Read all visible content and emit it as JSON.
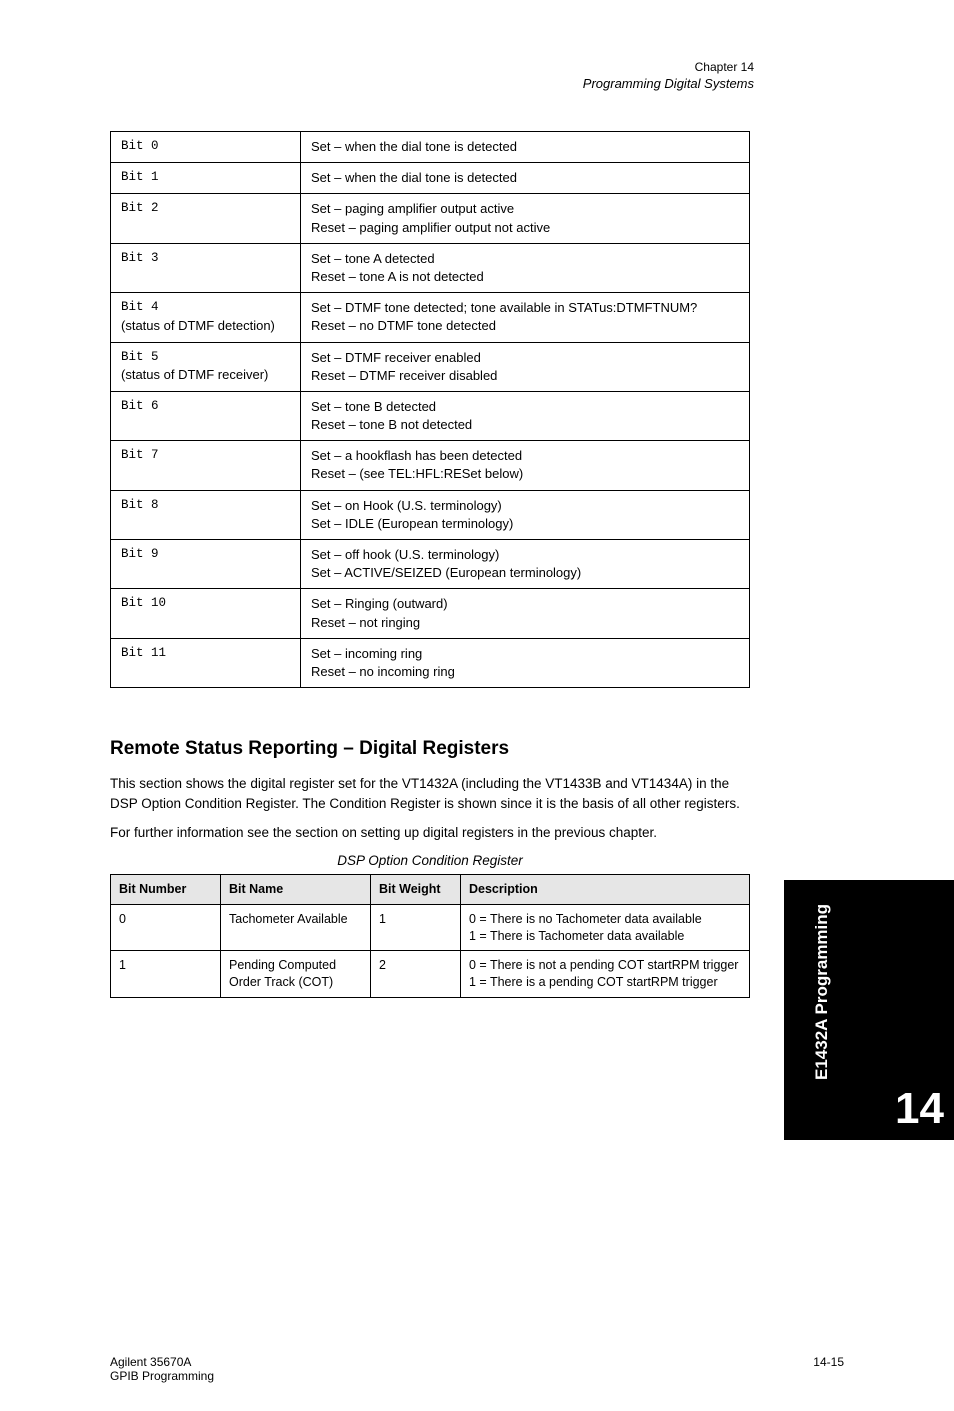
{
  "header": {
    "chapter": "Chapter 14",
    "title": "Programming Digital Systems"
  },
  "table1": {
    "rows": [
      {
        "field": "Bit 0",
        "desc": "Set – when the dial tone is detected"
      },
      {
        "field": "Bit 1",
        "desc": "Set – when the dial tone is detected"
      },
      {
        "field": "Bit 2",
        "desc_lines": [
          "Set – paging amplifier output active",
          "Reset – paging amplifier output not active"
        ]
      },
      {
        "field": "Bit 3",
        "desc_lines": [
          "Set – tone A detected",
          "Reset – tone A is not detected"
        ]
      },
      {
        "field_lines": [
          "Bit 4",
          "(status of DTMF detection)"
        ],
        "desc_lines": [
          "Set – DTMF tone detected; tone available in STATus:DTMFTNUM?",
          "Reset – no DTMF tone detected"
        ]
      },
      {
        "field_lines": [
          "Bit 5",
          "(status of DTMF receiver)"
        ],
        "desc_lines": [
          "Set – DTMF receiver enabled",
          "Reset – DTMF receiver disabled"
        ]
      },
      {
        "field": "Bit 6",
        "desc_lines": [
          "Set – tone B detected",
          "Reset – tone B not detected"
        ]
      },
      {
        "field": "Bit 7",
        "desc_lines": [
          "Set – a hookflash has been detected",
          "Reset – (see TEL:HFL:RESet below)"
        ]
      },
      {
        "field": "Bit 8",
        "desc_lines": [
          "Set – on Hook (U.S. terminology)",
          "Set – IDLE (European terminology)"
        ]
      },
      {
        "field": "Bit 9",
        "desc_lines": [
          "Set – off hook (U.S. terminology)",
          "Set – ACTIVE/SEIZED (European terminology)"
        ]
      },
      {
        "field": "Bit 10",
        "desc_lines": [
          "Set – Ringing (outward)",
          "Reset – not ringing"
        ]
      },
      {
        "field": "Bit 11",
        "desc_lines": [
          "Set – incoming ring",
          "Reset – no incoming ring"
        ]
      }
    ]
  },
  "section": {
    "title": "Remote Status Reporting – Digital Registers",
    "para1": "This section shows the digital register set for the VT1432A (including the VT1433B and VT1434A) in the DSP Option Condition Register. The Condition Register is shown since it is the basis of all other registers.",
    "para2": "For further information see the section on setting up digital registers in the previous chapter.",
    "caption": "DSP Option Condition Register"
  },
  "table2": {
    "headers": [
      "Bit Number",
      "Bit Name",
      "Bit Weight",
      "Description"
    ],
    "rows": [
      {
        "c1": "0",
        "c2": "Tachometer Available",
        "c3": "1",
        "c4_lines": [
          "0 = There is no Tachometer data available",
          "1 = There is Tachometer data available"
        ]
      },
      {
        "c1": "1",
        "c2": "Pending Computed Order Track (COT)",
        "c3": "2",
        "c4_lines": [
          "0 = There is not a pending COT startRPM trigger",
          "1 = There is a pending COT startRPM trigger"
        ]
      }
    ]
  },
  "side_tab": {
    "number": "14",
    "label": "E1432A Programming"
  },
  "footer": {
    "product": "Agilent 35670A",
    "page": "14-15",
    "book": "GPIB Programming"
  }
}
